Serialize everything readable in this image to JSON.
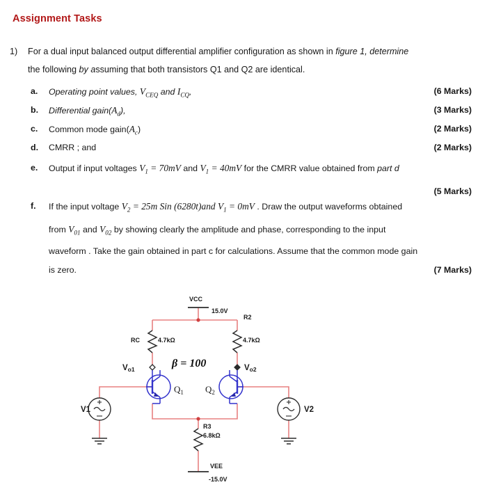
{
  "document": {
    "title": "Assignment Tasks",
    "title_color": "#b21818"
  },
  "question": {
    "number": "1)",
    "line1_a": "For a dual input balanced output differential amplifier configuration as shown in ",
    "line1_b": "figure 1, determine",
    "line2_a": "the following ",
    "line2_b": "by a",
    "line2_c": "ssuming that both transistors Q1 and Q2 are identical."
  },
  "items": [
    {
      "letter": "a.",
      "marks": "(6 Marks)"
    },
    {
      "letter": "b.",
      "marks": "(3 Marks)"
    },
    {
      "letter": "c.",
      "marks": "(2 Marks)"
    },
    {
      "letter": "d.",
      "text": "CMRR ; and",
      "marks": "(2 Marks)"
    }
  ],
  "item_a": {
    "prefix": "Operating point values, ",
    "v": "V",
    "v_sub": "CEQ",
    "mid": " and ",
    "i": "I",
    "i_sub": "CQ",
    "suffix": ","
  },
  "item_b": {
    "prefix": "Differential gain(",
    "a": "A",
    "a_sub": "d",
    "suffix": "),"
  },
  "item_c": {
    "prefix": "Common mode gain(",
    "a": "A",
    "a_sub": "c",
    "suffix": ")"
  },
  "item_e": {
    "letter": "e.",
    "t1": "Output if input voltages  ",
    "v1": "V",
    "v1_sub": "1",
    "eq1": " = 70mV",
    "t2": " and ",
    "v2": "V",
    "v2_sub": "1",
    "eq2": " = 40mV",
    "t3": "  for the CMRR value obtained from ",
    "t3_ital": "part d",
    "marks": "(5 Marks)"
  },
  "item_f": {
    "letter": "f.",
    "l1_a": "If the input voltage ",
    "l1_v2": "V",
    "l1_v2_sub": "2",
    "l1_eq": " = 25m Sin (6280t)",
    "l1_and": "and ",
    "l1_v1": "V",
    "l1_v1_sub": "1",
    "l1_eq2": " = 0mV",
    "l1_b": " . Draw the output waveforms obtained",
    "l2_a": "from ",
    "l2_v01": "V",
    "l2_v01_sub": "01",
    "l2_b": " and ",
    "l2_v02": "V",
    "l2_v02_sub": "02",
    "l2_c": " by showing clearly the amplitude and phase, corresponding to the input",
    "l3": "waveform . Take the gain obtained in part c for calculations. Assume that the common mode gain",
    "l4": "is zero.",
    "marks": "(7 Marks)"
  },
  "circuit": {
    "wire_color": "#e88080",
    "device_color": "#3333cc",
    "labels": {
      "vcc": "VCC",
      "vcc_value": "15.0V",
      "vee": "VEE",
      "vee_value": "-15.0V",
      "rc_name": "RC",
      "rc_value": "4.7kΩ",
      "r2_name": "R2",
      "r2_value": "4.7kΩ",
      "r3_name": "R3",
      "r3_value": "6.8kΩ",
      "vo1": "V",
      "vo1_sub": "o1",
      "vo2": "V",
      "vo2_sub": "o2",
      "q1": "Q",
      "q1_sub": "1",
      "q2": "Q",
      "q2_sub": "2",
      "beta": "β = 100",
      "v1": "V1",
      "v2": "V2"
    }
  }
}
